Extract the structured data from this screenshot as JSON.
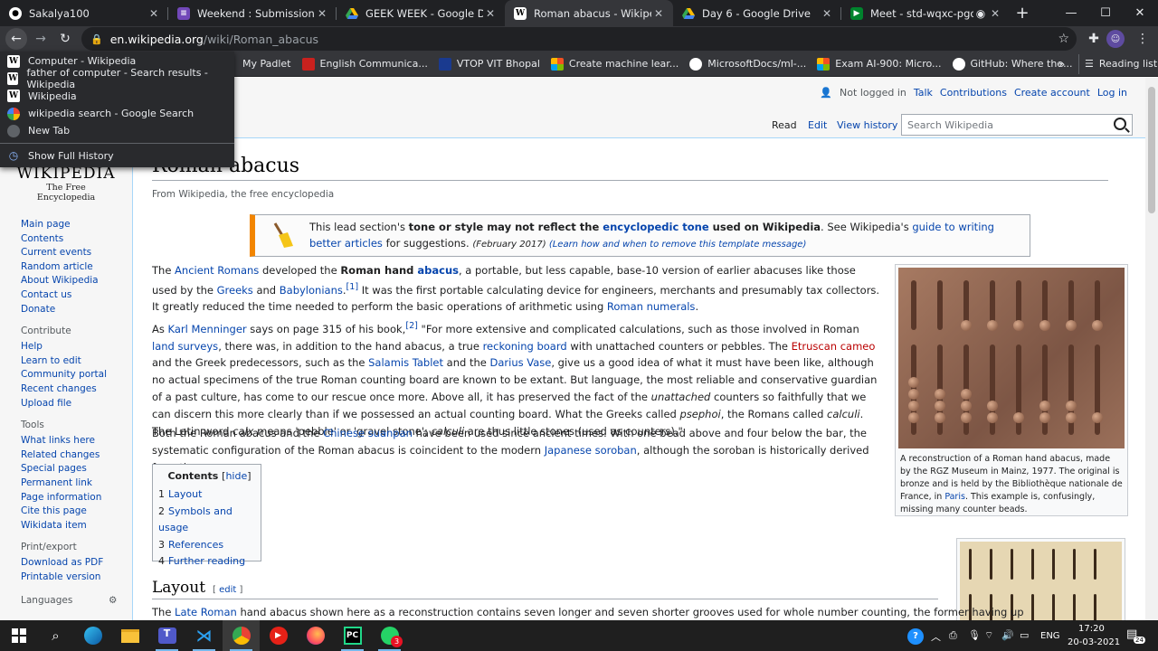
{
  "browser": {
    "tabs": [
      {
        "title": "Sakalya100",
        "icon": "github-icon"
      },
      {
        "title": "Weekend : Submission Form",
        "icon": "forms-icon"
      },
      {
        "title": "GEEK WEEK - Google Drive",
        "icon": "drive-icon"
      },
      {
        "title": "Roman abacus - Wikipedia",
        "icon": "wikipedia-icon"
      },
      {
        "title": "Day 6 - Google Drive",
        "icon": "drive-icon"
      },
      {
        "title": "Meet - std-wqxc-pgo",
        "icon": "meet-icon"
      }
    ],
    "url_host": "en.wikipedia.org",
    "url_path": "/wiki/Roman_abacus",
    "bookmarks": [
      "My Padlet",
      "English Communica...",
      "VTOP VIT Bhopal",
      "Create machine lear...",
      "MicrosoftDocs/ml-...",
      "Exam AI-900: Micro...",
      "GitHub: Where the..."
    ],
    "reading_list": "Reading list",
    "history_dropdown": [
      "Computer - Wikipedia",
      "father of computer - Search results - Wikipedia",
      "Wikipedia",
      "wikipedia search - Google Search",
      "New Tab"
    ],
    "show_full_history": "Show Full History"
  },
  "wiki": {
    "user_links": {
      "not_logged_in": "Not logged in",
      "talk": "Talk",
      "contributions": "Contributions",
      "create_account": "Create account",
      "login": "Log in"
    },
    "view_tabs": {
      "read": "Read",
      "edit": "Edit",
      "history": "View history"
    },
    "search_placeholder": "Search Wikipedia",
    "logo_title": "Wikipedia",
    "logo_tagline": "The Free Encyclopedia",
    "sidebar": {
      "main": [
        "Main page",
        "Contents",
        "Current events",
        "Random article",
        "About Wikipedia",
        "Contact us",
        "Donate"
      ],
      "contribute_heading": "Contribute",
      "contribute": [
        "Help",
        "Learn to edit",
        "Community portal",
        "Recent changes",
        "Upload file"
      ],
      "tools_heading": "Tools",
      "tools": [
        "What links here",
        "Related changes",
        "Special pages",
        "Permanent link",
        "Page information",
        "Cite this page",
        "Wikidata item"
      ],
      "print_heading": "Print/export",
      "print": [
        "Download as PDF",
        "Printable version"
      ],
      "languages_heading": "Languages"
    },
    "title": "Roman abacus",
    "tagline": "From Wikipedia, the free encyclopedia",
    "ambox": {
      "t1": "This lead section's ",
      "t2": "tone or style may not reflect the ",
      "t3": "encyclopedic tone",
      "t4": " used on Wikipedia",
      "t5": ". See Wikipedia's ",
      "t6": "guide to writing better articles",
      "t7": " for suggestions. ",
      "date": "(February 2017)",
      "learn": "(Learn how and when to remove this template message)"
    },
    "infobox_caption_1": "A reconstruction of a Roman hand abacus, made by the RGZ Museum in Mainz, 1977. The original is bronze and is held by the Bibliothèque nationale de France, in ",
    "infobox_caption_link": "Paris",
    "infobox_caption_2": ". This example is, confusingly, missing many counter beads.",
    "toc": {
      "title": "Contents",
      "hide": "hide",
      "items": [
        {
          "num": "1",
          "label": "Layout"
        },
        {
          "num": "2",
          "label": "Symbols and usage"
        },
        {
          "num": "3",
          "label": "References"
        },
        {
          "num": "4",
          "label": "Further reading"
        }
      ]
    },
    "section_heading": "Layout",
    "section_edit": "edit",
    "bottom_text_link": "Late Roman",
    "bottom_text_pre": "The ",
    "bottom_text": " hand abacus shown here as a reconstruction contains seven longer and seven shorter grooves used for whole number counting, the former having up"
  },
  "taskbar": {
    "time": "17:20",
    "date": "20-03-2021",
    "lang": "ENG",
    "notif_count": "24",
    "whatsapp_badge": "3"
  }
}
